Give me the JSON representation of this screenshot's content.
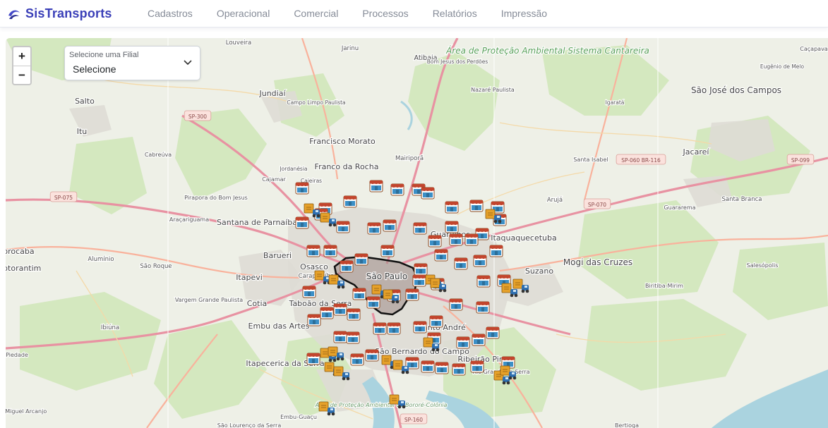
{
  "app": {
    "name": "SisTransports"
  },
  "nav": {
    "items": [
      "Cadastros",
      "Operacional",
      "Comercial",
      "Processos",
      "Relatórios",
      "Impressão"
    ]
  },
  "map": {
    "zoom_in": "+",
    "zoom_out": "−",
    "filial_select": {
      "label": "Selecione uma Filial",
      "value": "Selecione"
    },
    "places": [
      "Louveira",
      "Jarinu",
      "Atibaia",
      "Bom Jesus dos Perdões",
      "Nazaré Paulista",
      "Área de Proteção Ambiental Sistema Cantareira",
      "Eugênio de Melo",
      "Caçapava",
      "Salto",
      "Jundiaí",
      "Campo Limpo Paulista",
      "São José dos Campos",
      "Itu",
      "Francisco Morato",
      "Igaratá",
      "Cabreúva",
      "Jacareí",
      "Santa Isabel",
      "Franco da Rocha",
      "Mairiporã",
      "Jordanésia",
      "Cajamar",
      "Caieiras",
      "Pirapora do Bom Jesus",
      "Santa Branca",
      "Arujá",
      "Guararema",
      "Araçariguama",
      "Santana de Parnaíba",
      "Itaquaquecetuba",
      "Barueri",
      "Alumínio",
      "São Roque",
      "Osasco",
      "Mogi das Cruzes",
      "Carapicuíba",
      "Sorocaba",
      "Votorantim",
      "São Paulo",
      "Suzano",
      "Salesópolis",
      "Itapevi",
      "Biritiba-Mirim",
      "Vargem Grande Paulista",
      "Cotia",
      "Taboão da Serra",
      "Embu das Artes",
      "Santo André",
      "Ibiúna",
      "São Bernardo do Campo",
      "Piedade",
      "Itapecerica da Serra",
      "Ribeirão Pires",
      "Rio Grande da Serra",
      "Área de Proteção Ambiental do Bororé-Colônia",
      "São Miguel Arcanjo",
      "São Lourenço da Serra",
      "Embu-Guaçu",
      "Bertioga",
      "Guarulhos"
    ],
    "roads": [
      "SP-300",
      "SP-075",
      "SP-060 BR-116",
      "SP-099",
      "SP-070",
      "SP-160"
    ],
    "store_markers": 66,
    "truck_markers": 22
  },
  "colors": {
    "brand": "#3a3fb8",
    "nav_text": "#858b97",
    "forest": "#cfe6b7",
    "water": "#aad3df",
    "urban": "#dedcd5",
    "motorway": "#e892a2",
    "trunk": "#f9b29c",
    "region_fill": "#9c8b86",
    "store_icon": "#3b8fc6",
    "truck_icon": "#e6a12a"
  }
}
